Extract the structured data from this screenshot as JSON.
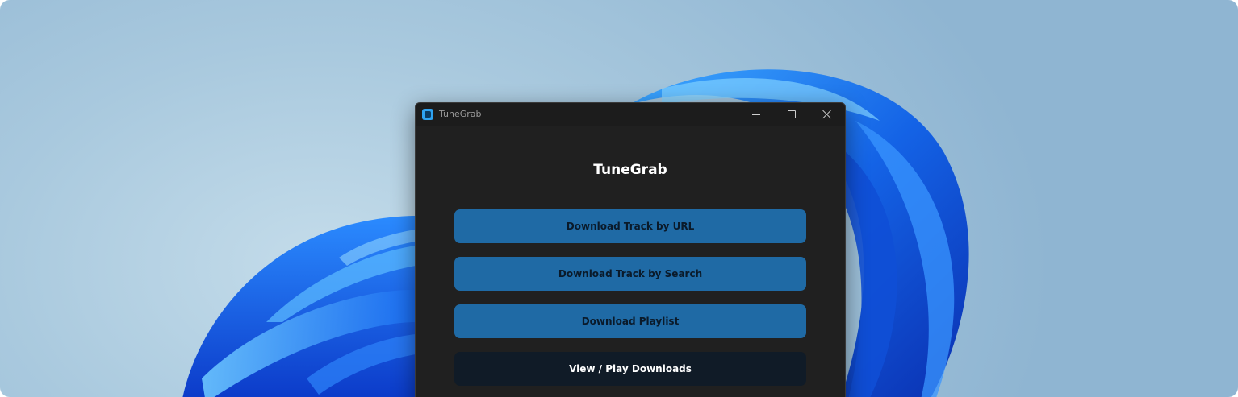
{
  "window": {
    "title": "TuneGrab",
    "controls": {
      "minimize": "minimize",
      "maximize": "maximize",
      "close": "close"
    }
  },
  "main": {
    "heading": "TuneGrab",
    "buttons": [
      {
        "label": "Download Track by URL"
      },
      {
        "label": "Download Track by Search"
      },
      {
        "label": "Download Playlist"
      },
      {
        "label": "View / Play Downloads"
      }
    ]
  },
  "colors": {
    "accent": "#1f6aa5",
    "dark_button": "#101b27",
    "window_bg": "#202020",
    "titlebar_bg": "#1c1c1c"
  },
  "icons": {
    "app": "app-icon",
    "minimize": "minimize-icon",
    "maximize": "maximize-icon",
    "close": "close-icon"
  }
}
